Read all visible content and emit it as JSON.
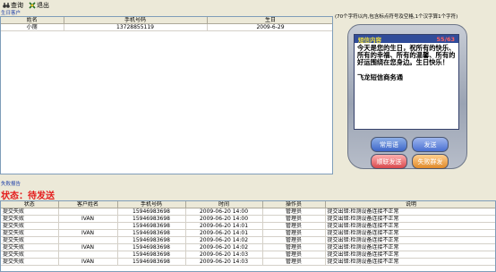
{
  "toolbar": {
    "query_label": "查询",
    "exit_label": "退出"
  },
  "birthday_section": {
    "title": "生日客户",
    "columns": [
      "姓名",
      "手机号码",
      "生日"
    ],
    "rows": [
      [
        "小丽",
        "13728855119",
        "2009-6-29"
      ]
    ]
  },
  "hint": "(70个字符以内,包含标点符号及空格,1个汉字算1个字符)",
  "sms": {
    "header_title": "短信内容",
    "counter": "55/63",
    "message": "今天是您的生日，祝所有的快乐、所有的幸福、所有的温馨、所有的好运围绕在您身边。生日快乐！\n\n飞龙短信商务通",
    "btn_common": "常用语",
    "btn_send": "发送",
    "btn_send_all": "顺联发送",
    "btn_group": "失败群发"
  },
  "fail_section": {
    "title": "失败报告",
    "status_label": "状态：",
    "status_value": "待发送",
    "columns": [
      "状态",
      "客户姓名",
      "手机号码",
      "时间",
      "操作员",
      "说明"
    ],
    "rows": [
      [
        "提交失败",
        "",
        "15946983698",
        "2009-06-20 14:00",
        "管理员",
        "提交出错:检测设备连接不正常"
      ],
      [
        "提交失败",
        "IVAN",
        "15946983698",
        "2009-06-20 14:00",
        "管理员",
        "提交出错:检测设备连接不正常"
      ],
      [
        "提交失败",
        "",
        "15946983698",
        "2009-06-20 14:01",
        "管理员",
        "提交出错:检测设备连接不正常"
      ],
      [
        "提交失败",
        "IVAN",
        "15946983698",
        "2009-06-20 14:01",
        "管理员",
        "提交出错:检测设备连接不正常"
      ],
      [
        "提交失败",
        "",
        "15946983698",
        "2009-06-20 14:02",
        "管理员",
        "提交出错:检测设备连接不正常"
      ],
      [
        "提交失败",
        "IVAN",
        "15946983698",
        "2009-06-20 14:02",
        "管理员",
        "提交出错:检测设备连接不正常"
      ],
      [
        "提交失败",
        "",
        "15946983698",
        "2009-06-20 14:03",
        "管理员",
        "提交出错:检测设备连接不正常"
      ],
      [
        "提交失败",
        "IVAN",
        "15946983698",
        "2009-06-20 14:03",
        "管理员",
        "提交出错:检测设备连接不正常"
      ]
    ]
  }
}
